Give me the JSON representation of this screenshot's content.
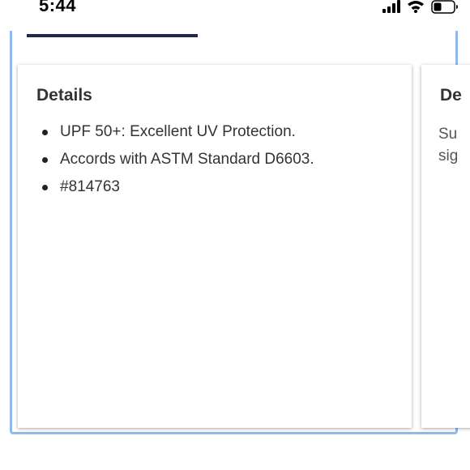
{
  "status_bar": {
    "time": "5:44",
    "icons": [
      "cellular-signal-icon",
      "wifi-icon",
      "battery-icon"
    ]
  },
  "details_card": {
    "title": "Details",
    "bullets": [
      "UPF 50+: Excellent UV Protection.",
      "Accords with ASTM Standard D6603.",
      "#814763"
    ]
  },
  "next_card": {
    "title": "De",
    "body_lines": [
      "Su",
      "sig"
    ]
  },
  "colors": {
    "frame_border": "#8fbaf0",
    "tab_indicator": "#1b2b4b",
    "text": "#333333"
  }
}
